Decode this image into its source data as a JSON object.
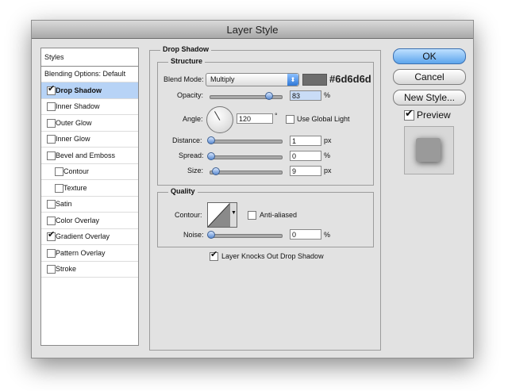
{
  "window": {
    "title": "Layer Style"
  },
  "styles_list": {
    "header": "Styles",
    "items": [
      {
        "label": "Blending Options: Default",
        "checkbox": false,
        "checked": false,
        "selected": false,
        "indent": 0
      },
      {
        "label": "Drop Shadow",
        "checkbox": true,
        "checked": true,
        "selected": true,
        "indent": 0
      },
      {
        "label": "Inner Shadow",
        "checkbox": true,
        "checked": false,
        "selected": false,
        "indent": 0
      },
      {
        "label": "Outer Glow",
        "checkbox": true,
        "checked": false,
        "selected": false,
        "indent": 0
      },
      {
        "label": "Inner Glow",
        "checkbox": true,
        "checked": false,
        "selected": false,
        "indent": 0
      },
      {
        "label": "Bevel and Emboss",
        "checkbox": true,
        "checked": false,
        "selected": false,
        "indent": 0
      },
      {
        "label": "Contour",
        "checkbox": true,
        "checked": false,
        "selected": false,
        "indent": 1
      },
      {
        "label": "Texture",
        "checkbox": true,
        "checked": false,
        "selected": false,
        "indent": 1
      },
      {
        "label": "Satin",
        "checkbox": true,
        "checked": false,
        "selected": false,
        "indent": 0
      },
      {
        "label": "Color Overlay",
        "checkbox": true,
        "checked": false,
        "selected": false,
        "indent": 0
      },
      {
        "label": "Gradient Overlay",
        "checkbox": true,
        "checked": true,
        "selected": false,
        "indent": 0
      },
      {
        "label": "Pattern Overlay",
        "checkbox": true,
        "checked": false,
        "selected": false,
        "indent": 0
      },
      {
        "label": "Stroke",
        "checkbox": true,
        "checked": false,
        "selected": false,
        "indent": 0
      }
    ]
  },
  "drop_shadow": {
    "title": "Drop Shadow",
    "structure": {
      "title": "Structure",
      "blend_mode_label": "Blend Mode:",
      "blend_mode_value": "Multiply",
      "color_hex": "#6d6d6d",
      "opacity_label": "Opacity:",
      "opacity_value": "83",
      "opacity_level": 0.83,
      "opacity_unit": "%",
      "angle_label": "Angle:",
      "angle_value": "120",
      "angle_unit": "°",
      "use_global_light_label": "Use Global Light",
      "use_global_light_checked": false,
      "distance_label": "Distance:",
      "distance_value": "1",
      "distance_unit": "px",
      "spread_label": "Spread:",
      "spread_value": "0",
      "spread_unit": "%",
      "size_label": "Size:",
      "size_value": "9",
      "size_unit": "px"
    },
    "quality": {
      "title": "Quality",
      "contour_label": "Contour:",
      "anti_aliased_label": "Anti-aliased",
      "anti_aliased_checked": false,
      "noise_label": "Noise:",
      "noise_value": "0",
      "noise_unit": "%"
    },
    "knockout_label": "Layer Knocks Out Drop Shadow",
    "knockout_checked": true
  },
  "buttons": {
    "ok": "OK",
    "cancel": "Cancel",
    "new_style": "New Style..."
  },
  "preview": {
    "label": "Preview",
    "checked": true
  },
  "colors": {
    "accent": "#5da5ec",
    "selection": "#b7d3f6",
    "shadow_swatch": "#6d6d6d"
  }
}
